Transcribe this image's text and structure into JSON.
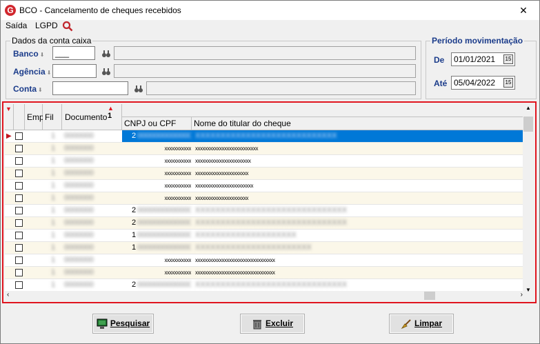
{
  "window": {
    "title": "BCO - Cancelamento de cheques recebidos",
    "app_icon": "G",
    "close_label": "✕"
  },
  "menu": {
    "items": [
      "Saída",
      "LGPD"
    ],
    "search_icon": "search-icon"
  },
  "account_group": {
    "legend": "Dados da conta caixa",
    "banco_label": "Banco",
    "banco_value": "___",
    "agencia_label": "Agência",
    "agencia_value": "",
    "conta_label": "Conta",
    "conta_value": ""
  },
  "period_group": {
    "legend": "Período movimentação",
    "de_label": "De",
    "de_value": "01/01/2021",
    "ate_label": "Até",
    "ate_value": "05/04/2022",
    "calendar_label": "15"
  },
  "grid": {
    "headers": {
      "emp": "Emp",
      "fil": "Fil",
      "documento": "Documento",
      "sort_indicator": "1",
      "cnpj": "CNPJ ou CPF",
      "titular": "Nome do titular do cheque"
    },
    "rows": [
      {
        "emp": "",
        "fil": "1",
        "doc": "0000000",
        "cnpj_prefix": "2",
        "cnpj": "00000000000000",
        "titular": "XXXXXXXXXXXXXXXXXXXXXXXXXXXX",
        "selected": true,
        "blur": true
      },
      {
        "emp": "",
        "fil": "1",
        "doc": "0000000",
        "cnpj_prefix": "",
        "cnpj": "xxxxxxxxxxx",
        "titular": "xxxxxxxxxxxxxxxxxxxxxxxxxx",
        "selected": false,
        "blur": false
      },
      {
        "emp": "",
        "fil": "1",
        "doc": "0000000",
        "cnpj_prefix": "",
        "cnpj": "xxxxxxxxxxx",
        "titular": "xxxxxxxxxxxxxxxxxxxxxxx",
        "selected": false,
        "blur": false
      },
      {
        "emp": "",
        "fil": "1",
        "doc": "0000000",
        "cnpj_prefix": "",
        "cnpj": "xxxxxxxxxxx",
        "titular": "xxxxxxxxxxxxxxxxxxxxxx",
        "selected": false,
        "blur": false
      },
      {
        "emp": "",
        "fil": "1",
        "doc": "0000000",
        "cnpj_prefix": "",
        "cnpj": "xxxxxxxxxxx",
        "titular": "xxxxxxxxxxxxxxxxxxxxxxxx",
        "selected": false,
        "blur": false
      },
      {
        "emp": "",
        "fil": "1",
        "doc": "0000000",
        "cnpj_prefix": "",
        "cnpj": "xxxxxxxxxxx",
        "titular": "xxxxxxxxxxxxxxxxxxxxxx",
        "selected": false,
        "blur": false
      },
      {
        "emp": "",
        "fil": "1",
        "doc": "0000000",
        "cnpj_prefix": "2",
        "cnpj": "00000000000000",
        "titular": "XXXXXXXXXXXXXXXXXXXXXXXXXXXXXX",
        "selected": false,
        "blur": true
      },
      {
        "emp": "",
        "fil": "1",
        "doc": "0000000",
        "cnpj_prefix": "2",
        "cnpj": "00000000000000",
        "titular": "XXXXXXXXXXXXXXXXXXXXXXXXXXXXXX",
        "selected": false,
        "blur": true
      },
      {
        "emp": "",
        "fil": "1",
        "doc": "0000000",
        "cnpj_prefix": "1",
        "cnpj": "00000000000000",
        "titular": "XXXXXXXXXXXXXXXXXXXX",
        "selected": false,
        "blur": true
      },
      {
        "emp": "",
        "fil": "1",
        "doc": "0000000",
        "cnpj_prefix": "1",
        "cnpj": "00000000000000",
        "titular": "XXXXXXXXXXXXXXXXXXXXXXX",
        "selected": false,
        "blur": true
      },
      {
        "emp": "",
        "fil": "1",
        "doc": "0000000",
        "cnpj_prefix": "",
        "cnpj": "xxxxxxxxxxx",
        "titular": "xxxxxxxxxxxxxxxxxxxxxxxxxxxxxxxxx",
        "selected": false,
        "blur": false
      },
      {
        "emp": "",
        "fil": "1",
        "doc": "0000000",
        "cnpj_prefix": "",
        "cnpj": "xxxxxxxxxxx",
        "titular": "xxxxxxxxxxxxxxxxxxxxxxxxxxxxxxxxx",
        "selected": false,
        "blur": false
      },
      {
        "emp": "",
        "fil": "1",
        "doc": "0000000",
        "cnpj_prefix": "2",
        "cnpj": "00000000000000",
        "titular": "XXXXXXXXXXXXXXXXXXXXXXXXXXXXXX",
        "selected": false,
        "blur": true
      }
    ]
  },
  "buttons": {
    "pesquisar": "Pesquisar",
    "excluir": "Excluir",
    "limpar": "Limpar"
  },
  "colors": {
    "accent_red": "#e0141e",
    "selection_blue": "#0078d7",
    "label_blue": "#1a3b8a",
    "alt_row": "#fbf7e9"
  }
}
